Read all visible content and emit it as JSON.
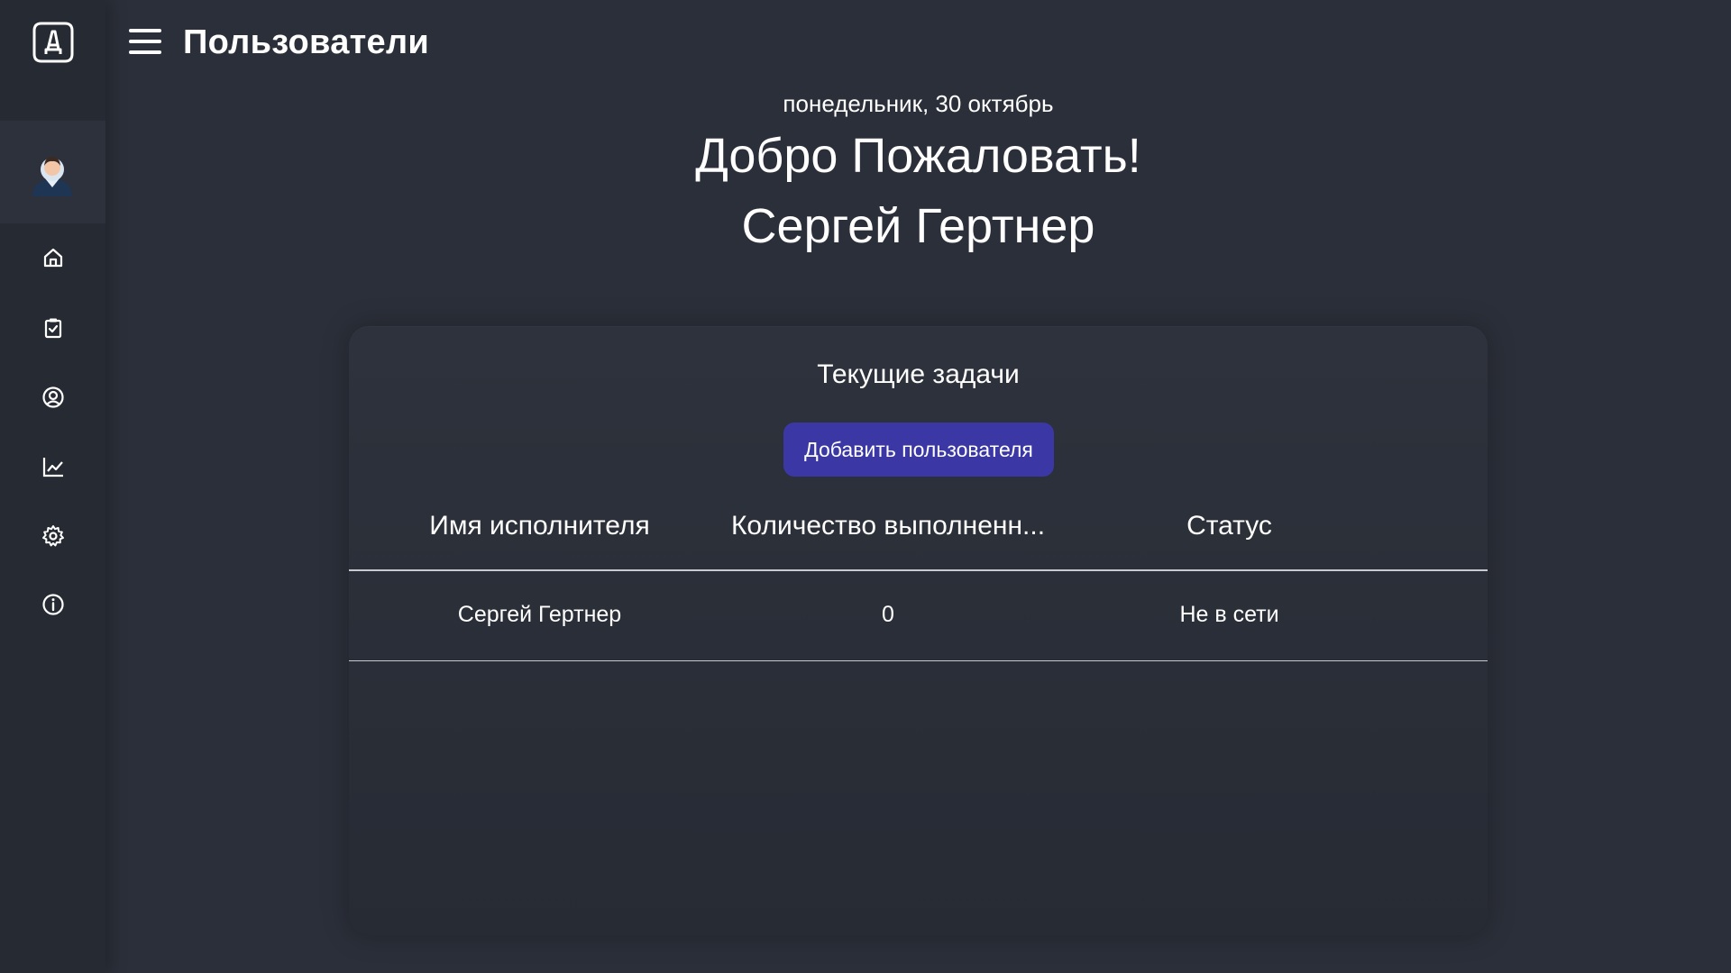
{
  "header": {
    "title": "Пользователи"
  },
  "sidebar": {
    "logo_icon": "logo-icon",
    "avatar_icon": "user-avatar-icon",
    "items": [
      {
        "icon": "home-icon"
      },
      {
        "icon": "tasks-icon"
      },
      {
        "icon": "user-circle-icon"
      },
      {
        "icon": "chart-icon"
      },
      {
        "icon": "gear-icon"
      },
      {
        "icon": "info-icon"
      }
    ]
  },
  "greeting": {
    "date": "понедельник, 30 октябрь",
    "welcome": "Добро Пожаловать!",
    "username": "Сергей Гертнер"
  },
  "card": {
    "title": "Текущие задачи",
    "add_button": "Добавить пользователя",
    "columns": [
      "Имя исполнителя",
      "Количество выполненн...",
      "Статус"
    ],
    "rows": [
      {
        "name": "Сергей Гертнер",
        "count": "0",
        "status": "Не в сети"
      }
    ]
  },
  "colors": {
    "background": "#2b2f39",
    "sidebar": "#262a33",
    "accent_button": "#3b38a5",
    "text": "#ffffff"
  }
}
